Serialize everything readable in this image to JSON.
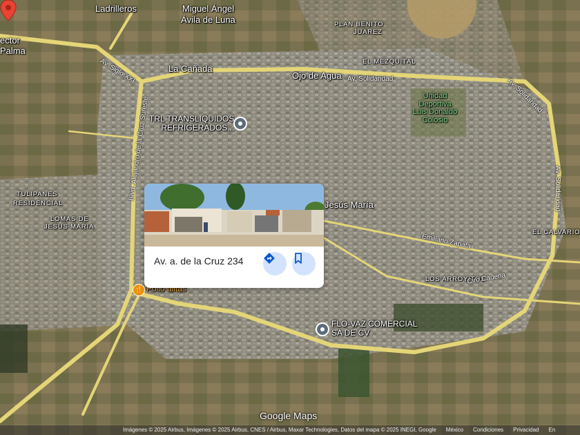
{
  "map": {
    "place_labels": [
      {
        "name": "label-ladrilleros",
        "text": "Ladrilleros",
        "cls": "big"
      },
      {
        "name": "label-miguel-angel",
        "text": "Miguel Ángel",
        "cls": "big"
      },
      {
        "name": "label-avila-de-luna",
        "text": "Ávila de Luna",
        "cls": "big"
      },
      {
        "name": "label-ector",
        "text": "ector",
        "cls": "big"
      },
      {
        "name": "label-palma",
        "text": "Palma",
        "cls": "big"
      },
      {
        "name": "label-la-canada",
        "text": "La Cañada",
        "cls": "big"
      },
      {
        "name": "label-ojo-de-agua",
        "text": "Ojo de Agua",
        "cls": "big"
      },
      {
        "name": "label-jesus-maria",
        "text": "Jesús María",
        "cls": "big"
      },
      {
        "name": "label-plan-benito",
        "text": "PLAN BENITO",
        "cls": "sm"
      },
      {
        "name": "label-juarez",
        "text": "JUAREZ",
        "cls": "sm"
      },
      {
        "name": "label-el-mezquital",
        "text": "EL MEZQUITAL",
        "cls": "sm"
      },
      {
        "name": "label-tulipanes",
        "text": "TULIPANES",
        "cls": "sm"
      },
      {
        "name": "label-residencial",
        "text": "RESIDENCIAL",
        "cls": "sm"
      },
      {
        "name": "label-lomas-de",
        "text": "LOMAS DE",
        "cls": "sm"
      },
      {
        "name": "label-jesus-maria-small",
        "text": "JESUS MARIA",
        "cls": "sm"
      },
      {
        "name": "label-el-calvario",
        "text": "EL CALVARIO",
        "cls": "sm"
      },
      {
        "name": "label-los-arroyitos",
        "text": "LOS ARROYITOS",
        "cls": "sm"
      }
    ],
    "road_labels": [
      {
        "name": "road-label-siglo-xxi",
        "text": "Av. Siglo XXI"
      },
      {
        "name": "road-label-solidaridad-1",
        "text": "Av. Solidaridad"
      },
      {
        "name": "road-label-solidaridad-2",
        "text": "Av. Solidaridad"
      },
      {
        "name": "road-label-solidaridad-3",
        "text": "Av. Solidaridad"
      },
      {
        "name": "road-label-alejandro-cruz",
        "text": "Blvd. Alejandro de la Cruz Sureste"
      },
      {
        "name": "road-label-emiliano-zapata",
        "text": "Emiliano Zapata"
      },
      {
        "name": "road-label-ciro-cadena",
        "text": "Ciro Cadena"
      }
    ],
    "park": {
      "line1": "Unidad",
      "line2": "Deportiva",
      "line3": "Luis Donaldo",
      "line4": "Colosio"
    },
    "pois": {
      "trl_line1": "TRL TRANSLIQUIDOS",
      "trl_line2": "REFRIGERADOS...",
      "flovaz_line1": "FLO-VAZ COMERCIAL",
      "flovaz_line2": "SA DE CV",
      "pollo": "Pollo alitas"
    }
  },
  "card": {
    "address": "Av. a. de la Cruz 234"
  },
  "logo": "Google Maps",
  "footer": {
    "attribution": "Imágenes © 2025 Airbus, Imágenes © 2025 Airbus, CNES / Airbus, Maxar Technologies, Datos del mapa © 2025 INEGI, Google",
    "country": "México",
    "terms": "Condiciones",
    "privacy": "Privacidad",
    "more": "En"
  },
  "colors": {
    "road": "#e4d577",
    "card_button": "#d3e3fd",
    "marker": "#ea4335",
    "poi": "#5d6b7a",
    "food": "#f29100"
  }
}
